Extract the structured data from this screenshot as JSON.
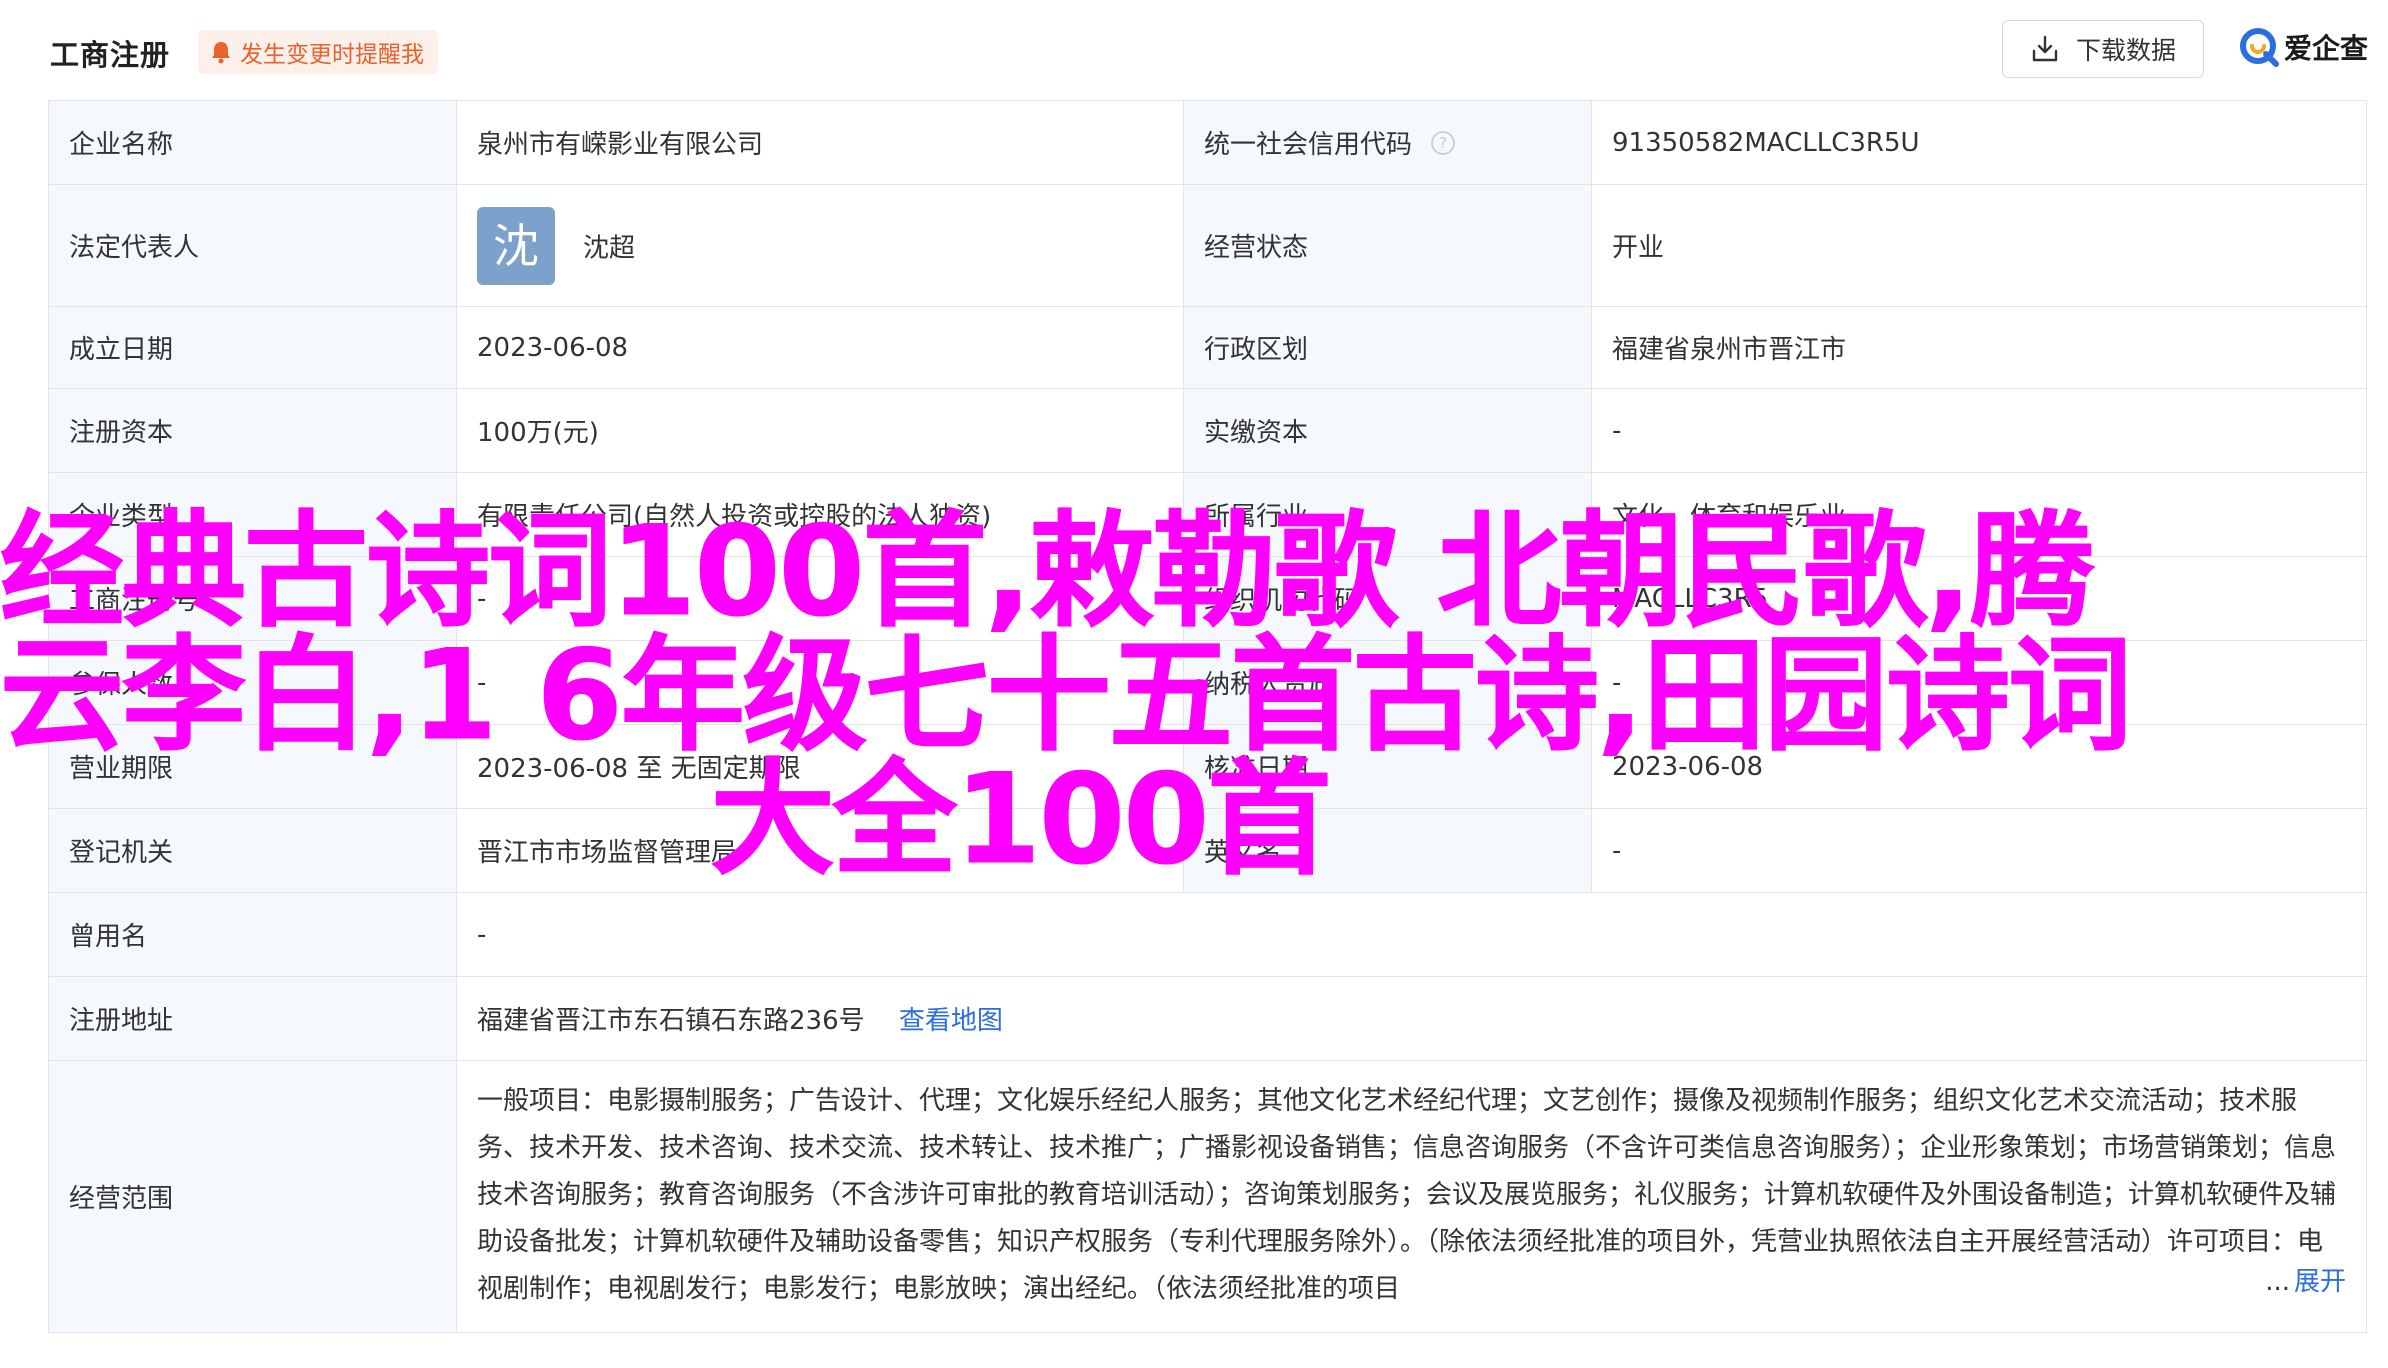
{
  "header": {
    "title": "工商注册",
    "alert_label": "发生变更时提醒我",
    "download_label": "下载数据",
    "brand_label": "爱企查",
    "accent_color": "#2a6ee0",
    "alert_color": "#e8622b"
  },
  "rows": {
    "company_name": {
      "label": "企业名称",
      "value": "泉州市有嵘影业有限公司"
    },
    "credit_code": {
      "label": "统一社会信用代码",
      "value": "91350582MACLLC3R5U"
    },
    "legal_rep": {
      "label": "法定代表人",
      "avatar_char": "沈",
      "value": "沈超"
    },
    "status": {
      "label": "经营状态",
      "value": "开业"
    },
    "founded": {
      "label": "成立日期",
      "value": "2023-06-08"
    },
    "region": {
      "label": "行政区划",
      "value": "福建省泉州市晋江市"
    },
    "reg_capital": {
      "label": "注册资本",
      "value": "100万(元)"
    },
    "paid_capital": {
      "label": "实缴资本",
      "value": "-"
    },
    "company_type": {
      "label": "企业类型",
      "value": "有限责任公司(自然人投资或控股的法人独资)"
    },
    "industry": {
      "label": "所属行业",
      "value": "文化、体育和娱乐业"
    },
    "reg_no": {
      "label": "工商注册号",
      "value": "-"
    },
    "org_code": {
      "label": "组织机构代码",
      "value": "MACLLC3R5"
    },
    "insured": {
      "label": "参保人数",
      "value": "-"
    },
    "taxpayer": {
      "label": "纳税人资质",
      "value": "-"
    },
    "term": {
      "label": "营业期限",
      "value": "2023-06-08 至 无固定期限"
    },
    "approval_date": {
      "label": "核准日期",
      "value": "2023-06-08"
    },
    "authority": {
      "label": "登记机关",
      "value": "晋江市市场监督管理局"
    },
    "english_name": {
      "label": "英文名",
      "value": "-"
    },
    "former_name": {
      "label": "曾用名",
      "value": "-"
    },
    "address": {
      "label": "注册地址",
      "value": "福建省晋江市东石镇石东路236号",
      "link": "查看地图"
    },
    "scope": {
      "label": "经营范围",
      "value": "一般项目：电影摄制服务；广告设计、代理；文化娱乐经纪人服务；其他文化艺术经纪代理；文艺创作；摄像及视频制作服务；组织文化艺术交流活动；技术服务、技术开发、技术咨询、技术交流、技术转让、技术推广；广播影视设备销售；信息咨询服务（不含许可类信息咨询服务）；企业形象策划；市场营销策划；信息技术咨询服务；教育咨询服务（不含涉许可审批的教育培训活动）；咨询策划服务；会议及展览服务；礼仪服务；计算机软硬件及外围设备制造；计算机软硬件及辅助设备批发；计算机软硬件及辅助设备零售；知识产权服务（专利代理服务除外）。（除依法须经批准的项目外，凭营业执照依法自主开展经营活动）许可项目：电视剧制作；电视剧发行；电影发行；电影放映；演出经纪。（依法须经批准的项目",
      "ellipsis": "...",
      "expand_label": "展开"
    }
  },
  "overlay": {
    "line1": "经典古诗词100首,敕勒歌 北朝民歌,腾",
    "line2": "云李白,1 6年级七十五首古诗,田园诗词",
    "line3": "大全100首",
    "color": "#ff00ff"
  }
}
